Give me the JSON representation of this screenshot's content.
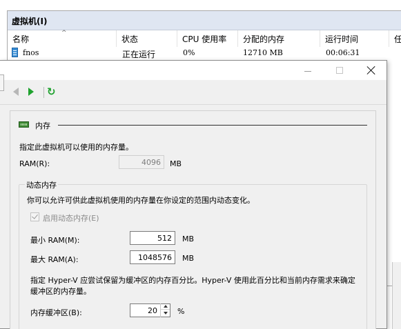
{
  "background": {
    "section_title": "虚拟机(I)",
    "columns": [
      "名称",
      "状态",
      "CPU 使用率",
      "分配的内存",
      "运行时间",
      "任"
    ],
    "vm_row": {
      "name": "fnos",
      "state": "正在运行",
      "cpu": "0%",
      "memory": "12710 MB",
      "uptime": "00:06:31"
    }
  },
  "dialog": {
    "title_buttons": {
      "minimize": "minimize",
      "maximize": "maximize",
      "close": "close"
    },
    "toolbar": {
      "back_icon": "back-arrow-icon",
      "forward_icon": "forward-play-icon",
      "refresh_symbol": "↻"
    },
    "memory": {
      "section_title": "内存",
      "description": "指定此虚拟机可以使用的内存量。",
      "ram_label": "RAM(R):",
      "ram_value": "4096",
      "unit_mb": "MB",
      "dynamic_group_title": "动态内存",
      "dynamic_description": "你可以允许可供此虚拟机使用的内存量在你设定的范围内动态变化。",
      "enable_dynamic_label": "启用动态内存(E)",
      "enable_dynamic_checked": true,
      "min_ram_label": "最小 RAM(M):",
      "min_ram_value": "512",
      "max_ram_label": "最大 RAM(A):",
      "max_ram_value": "1048576",
      "buffer_description_line1": "指定 Hyper-V 应尝试保留为缓冲区的内存百分比。Hyper-V 使用此百分比和当前内存需求来确定",
      "buffer_description_line2": "缓冲区的内存量。",
      "buffer_label": "内存缓冲区(B):",
      "buffer_value": "20",
      "percent_unit": "%"
    }
  }
}
